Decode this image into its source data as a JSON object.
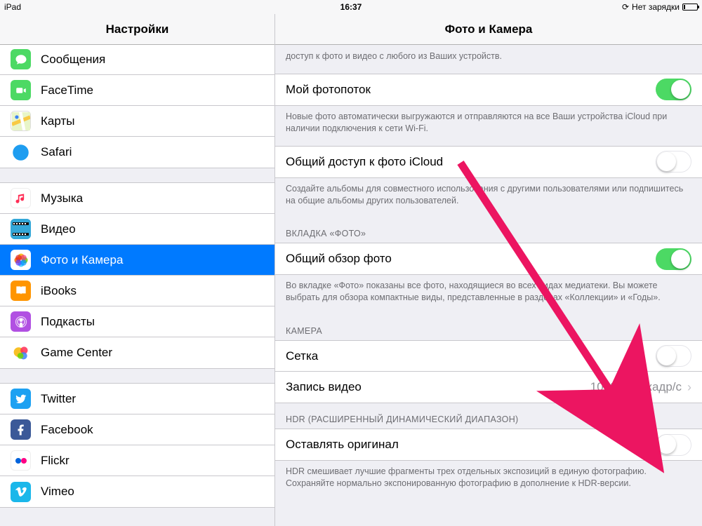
{
  "status": {
    "device": "iPad",
    "time": "16:37",
    "charging_text": "Нет зарядки"
  },
  "sidebar": {
    "title": "Настройки",
    "groups": [
      {
        "items": [
          {
            "key": "messages",
            "label": "Сообщения"
          },
          {
            "key": "facetime",
            "label": "FaceTime"
          },
          {
            "key": "maps",
            "label": "Карты"
          },
          {
            "key": "safari",
            "label": "Safari"
          }
        ]
      },
      {
        "items": [
          {
            "key": "music",
            "label": "Музыка"
          },
          {
            "key": "video",
            "label": "Видео"
          },
          {
            "key": "photos",
            "label": "Фото и Камера",
            "selected": true
          },
          {
            "key": "ibooks",
            "label": "iBooks"
          },
          {
            "key": "podcasts",
            "label": "Подкасты"
          },
          {
            "key": "gamecenter",
            "label": "Game Center"
          }
        ]
      },
      {
        "items": [
          {
            "key": "twitter",
            "label": "Twitter"
          },
          {
            "key": "facebook",
            "label": "Facebook"
          },
          {
            "key": "flickr",
            "label": "Flickr"
          },
          {
            "key": "vimeo",
            "label": "Vimeo"
          }
        ]
      }
    ]
  },
  "detail": {
    "title": "Фото и Камера",
    "top_footer": "доступ к фото и видео с любого из Ваших устройств.",
    "photostream": {
      "label": "Мой фотопоток",
      "on": true,
      "footer": "Новые фото автоматически выгружаются и отправляются на все Ваши устройства iCloud при наличии подключения к сети Wi-Fi."
    },
    "sharing": {
      "label": "Общий доступ к фото iCloud",
      "on": false,
      "footer": "Создайте альбомы для совместного использования с другими пользователями или подпишитесь на общие альбомы других пользователей."
    },
    "tab_header": "ВКЛАДКА «ФОТО»",
    "summary": {
      "label": "Общий обзор фото",
      "on": true,
      "footer": "Во вкладке «Фото» показаны все фото, находящиеся во всех видах медиатеки. Вы можете выбрать для обзора компактные виды, представленные в разделах «Коллекции» и «Годы»."
    },
    "camera_header": "КАМЕРА",
    "grid": {
      "label": "Сетка",
      "on": false
    },
    "record": {
      "label": "Запись видео",
      "value": "1080p, 30 кадр/с"
    },
    "hdr_header": "HDR (РАСШИРЕННЫЙ ДИНАМИЧЕСКИЙ ДИАПАЗОН)",
    "keep_original": {
      "label": "Оставлять оригинал",
      "on": false,
      "footer": "HDR смешивает лучшие фрагменты трех отдельных экспозиций в единую фотографию. Сохраняйте нормально экспонированную фотографию в дополнение к HDR-версии."
    }
  }
}
